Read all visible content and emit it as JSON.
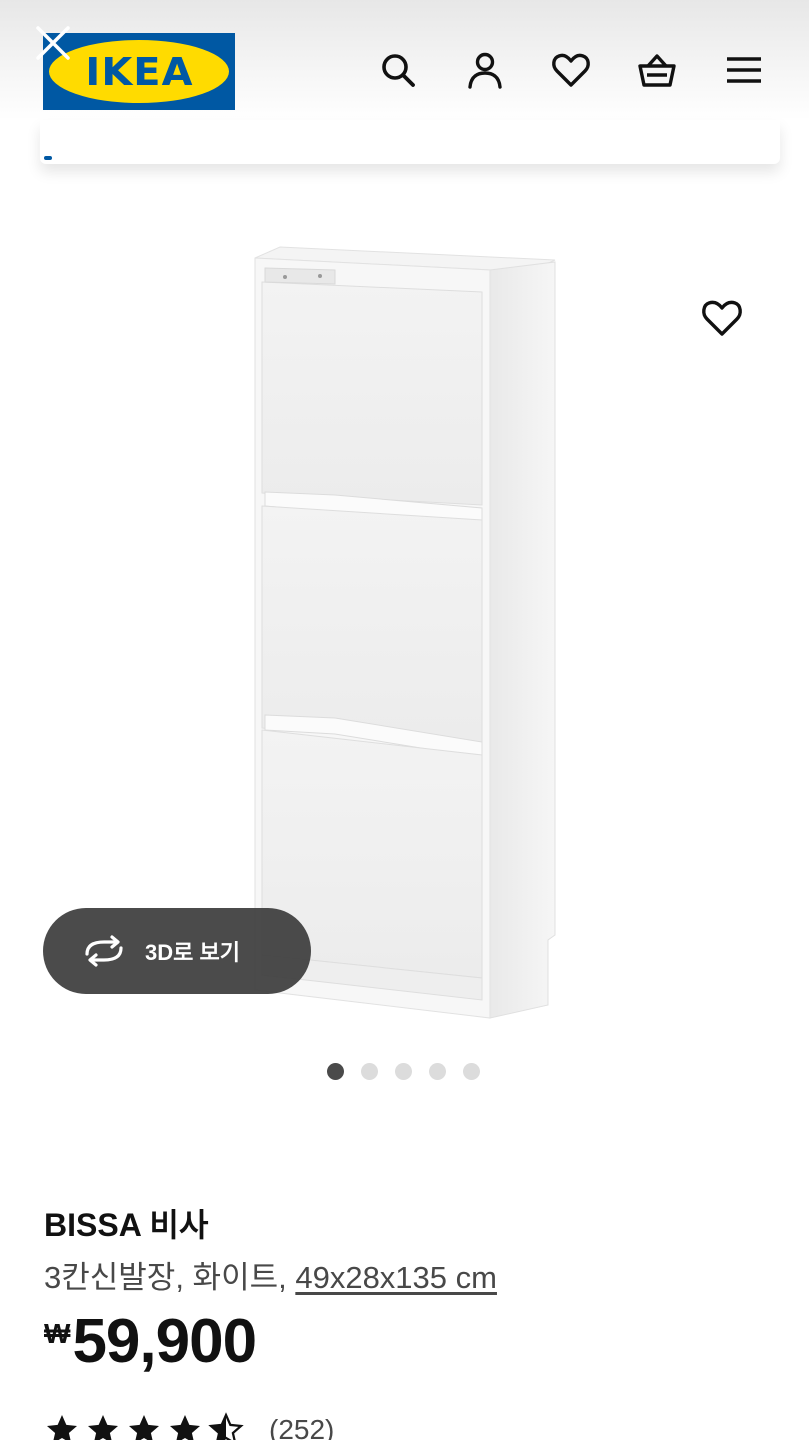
{
  "header": {
    "logo_text": "IKEA",
    "icons": [
      "close-icon",
      "search-icon",
      "account-icon",
      "heart-icon",
      "basket-icon",
      "menu-icon"
    ]
  },
  "gallery": {
    "view_3d_label": "3D로 보기",
    "image_count": 5,
    "active_image": 1
  },
  "product": {
    "name": "BISSA 비사",
    "description": "3칸신발장, 화이트, ",
    "dimensions": "49x28x135 cm",
    "currency": "₩",
    "price": "59,900",
    "rating": 4.5,
    "review_count": "(252)"
  },
  "colors": {
    "ikea_blue": "#0058a3",
    "ikea_yellow": "#ffdb00"
  }
}
